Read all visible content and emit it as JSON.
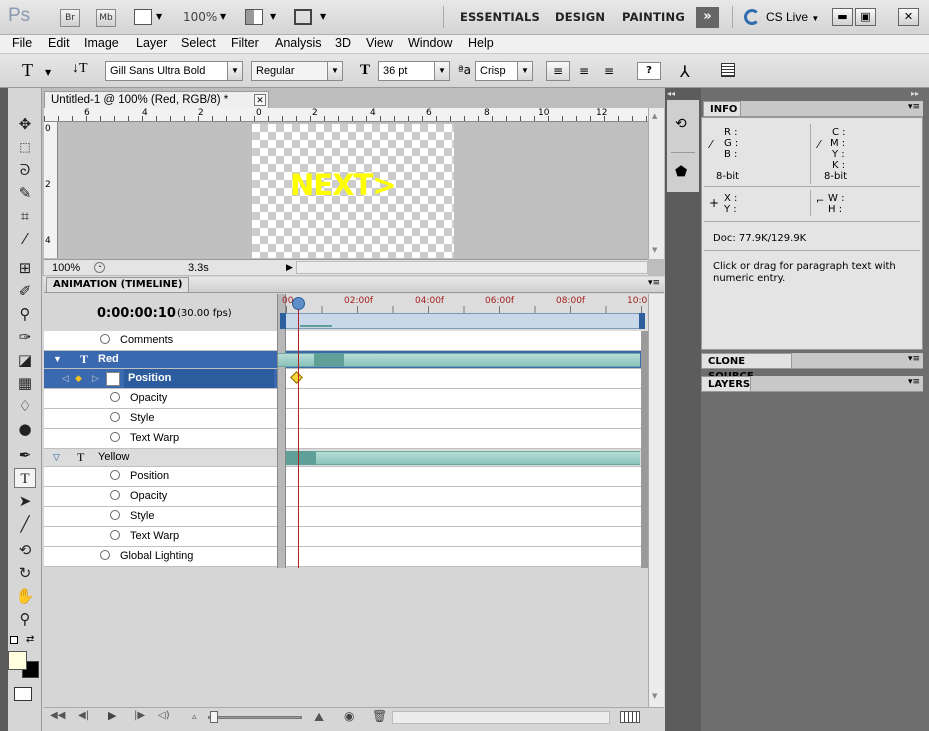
{
  "appbar": {
    "logo": "Ps",
    "br_label": "Br",
    "mb_label": "Mb",
    "zoom": "100%",
    "workspaces": [
      "ESSENTIALS",
      "DESIGN",
      "PAINTING"
    ],
    "cs_live": "CS Live"
  },
  "menubar": {
    "items": [
      "File",
      "Edit",
      "Image",
      "Layer",
      "Select",
      "Filter",
      "Analysis",
      "3D",
      "View",
      "Window",
      "Help"
    ]
  },
  "options": {
    "font_family": "Gill Sans Ultra Bold",
    "font_style": "Regular",
    "font_size": "36 pt",
    "aa_label": "a",
    "antialias": "Crisp",
    "help_btn": "?"
  },
  "document": {
    "tab_title": "Untitled-1 @ 100% (Red, RGB/8) *",
    "zoom": "100%",
    "timing": "3.3s",
    "canvas_text": "NEXT>",
    "canvas_text_color": "#ffff00",
    "ruler_h": [
      "6",
      "4",
      "2",
      "0",
      "2",
      "4",
      "6",
      "8",
      "10",
      "12"
    ],
    "ruler_v": [
      "0",
      "2",
      "4"
    ]
  },
  "timeline": {
    "title": "ANIMATION (TIMELINE)",
    "timecode": "0:00:00:10",
    "fps": "(30.00 fps)",
    "marks": [
      "00",
      "02:00f",
      "04:00f",
      "06:00f",
      "08:00f",
      "10:0"
    ],
    "rows": {
      "comments": "Comments",
      "red": "Red",
      "red_position": "Position",
      "red_opacity": "Opacity",
      "red_style": "Style",
      "red_textwarp": "Text Warp",
      "yellow": "Yellow",
      "y_position": "Position",
      "y_opacity": "Opacity",
      "y_style": "Style",
      "y_textwarp": "Text Warp",
      "global": "Global Lighting"
    },
    "accent": "#3a69b0",
    "track_color": "#8ac3bb"
  },
  "panels": {
    "info": "INFO",
    "clone": "CLONE SOURCE",
    "layers": "LAYERS",
    "r": "R :",
    "g": "G :",
    "b": "B :",
    "c": "C :",
    "m": "M :",
    "y": "Y :",
    "k": "K :",
    "bit1": "8-bit",
    "bit2": "8-bit",
    "x": "X :",
    "yy": "Y :",
    "w": "W :",
    "h": "H :",
    "doc": "Doc: 77.9K/129.9K",
    "hint": "Click or drag for paragraph text with numeric entry."
  }
}
